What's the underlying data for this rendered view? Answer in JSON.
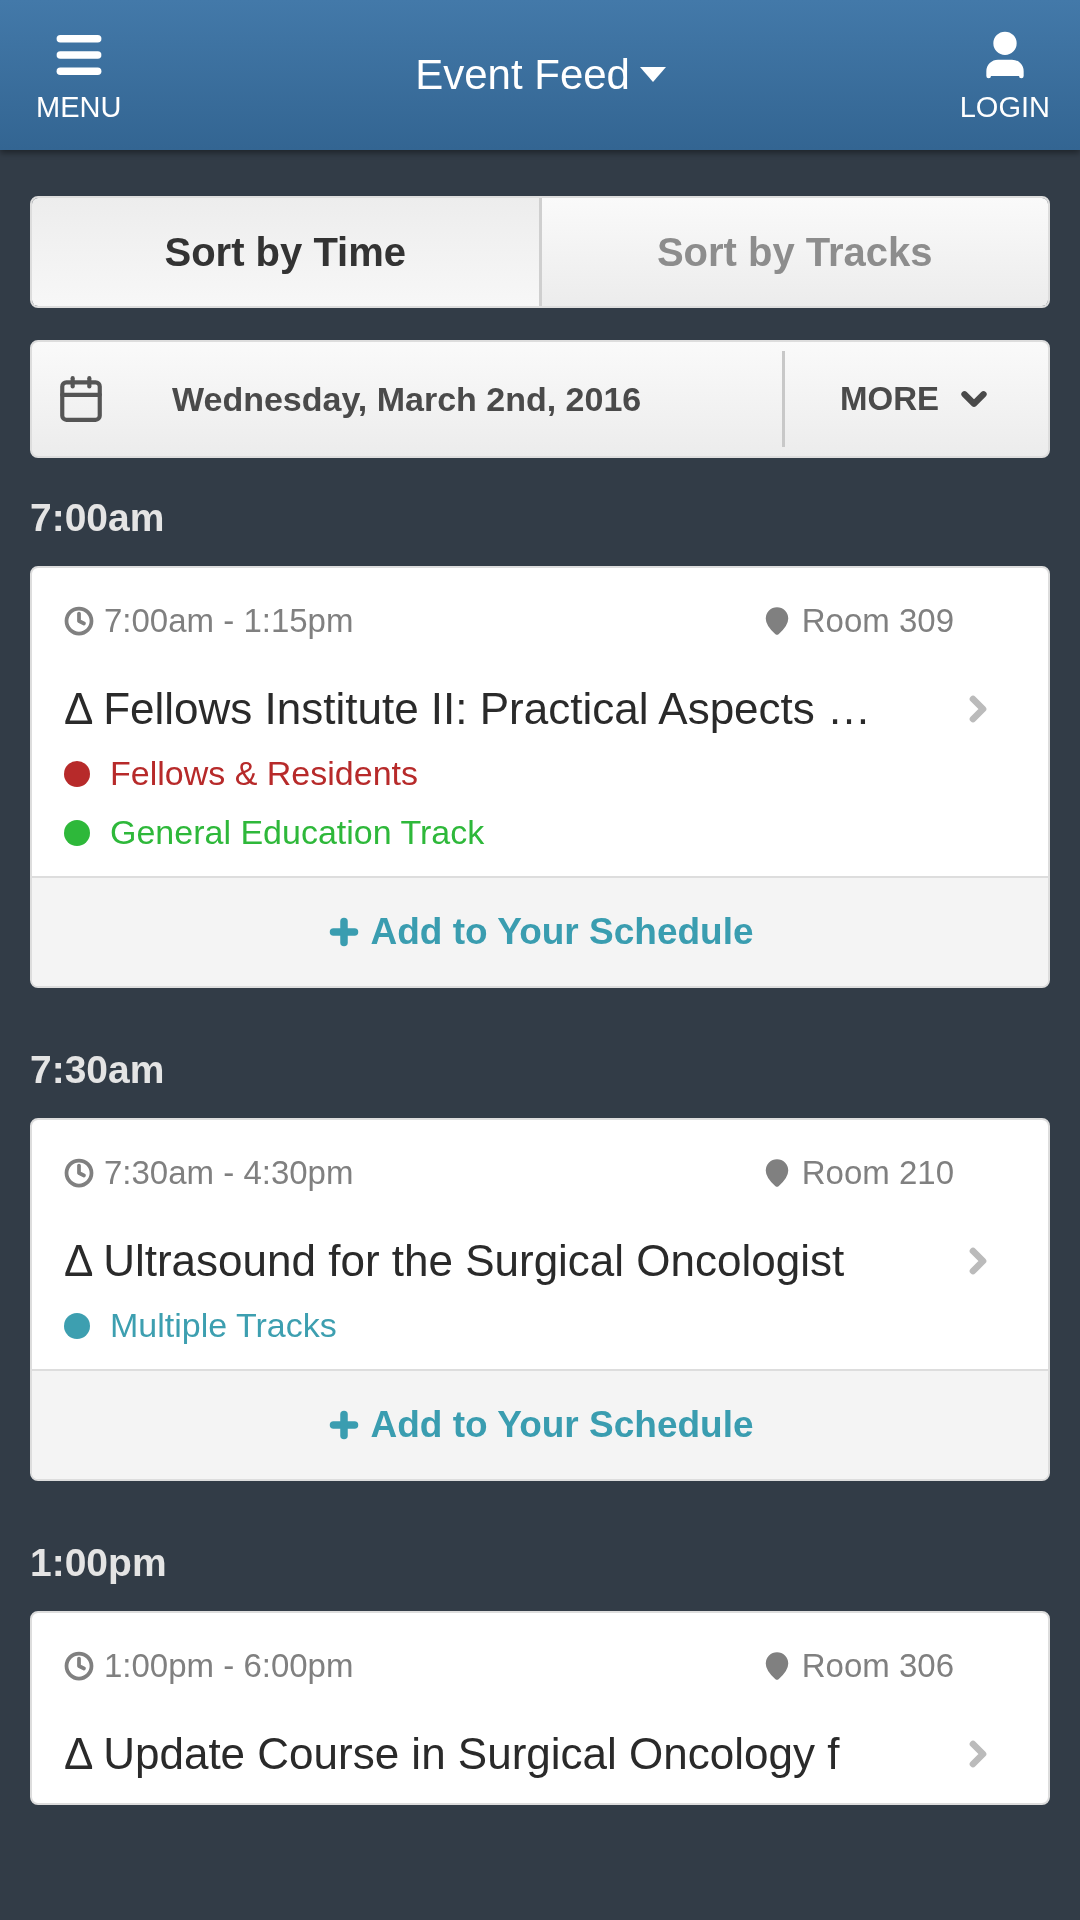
{
  "header": {
    "menu_label": "MENU",
    "title": "Event Feed",
    "login_label": "LOGIN"
  },
  "sort_tabs": [
    {
      "label": "Sort by Time",
      "selected": true
    },
    {
      "label": "Sort by Tracks",
      "selected": false
    }
  ],
  "date_bar": {
    "date": "Wednesday, March 2nd, 2016",
    "more_label": "MORE"
  },
  "groups": [
    {
      "time": "7:00am",
      "events": [
        {
          "time_range": "7:00am - 1:15pm",
          "room": "Room 309",
          "title": "Δ Fellows Institute II: Practical Aspects …",
          "tracks": [
            {
              "name": "Fellows & Residents",
              "color": "#b72a2a"
            },
            {
              "name": "General Education Track",
              "color": "#2eb83a"
            }
          ],
          "action": "Add to Your Schedule"
        }
      ]
    },
    {
      "time": "7:30am",
      "events": [
        {
          "time_range": "7:30am - 4:30pm",
          "room": "Room 210",
          "title": "Δ Ultrasound for the Surgical Oncologist",
          "tracks": [
            {
              "name": "Multiple Tracks",
              "color": "#3d9fb0"
            }
          ],
          "action": "Add to Your Schedule"
        }
      ]
    },
    {
      "time": "1:00pm",
      "events": [
        {
          "time_range": "1:00pm - 6:00pm",
          "room": "Room 306",
          "title": "Δ Update Course in Surgical Oncology f"
        }
      ]
    }
  ]
}
